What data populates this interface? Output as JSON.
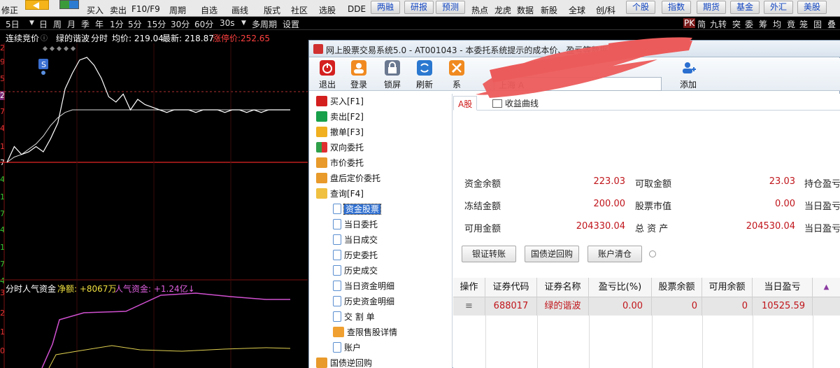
{
  "toolbar": {
    "left_label": "修正",
    "items": [
      "买入",
      "卖出",
      "F10/F9",
      "周期",
      "自选",
      "画线",
      "版式",
      "社区",
      "选股",
      "DDE"
    ],
    "pills_a": [
      "两融",
      "研报",
      "预测"
    ],
    "items_b": [
      "热点",
      "龙虎",
      "数据",
      "新股",
      "全球",
      "创/科"
    ],
    "pills_b": [
      "个股",
      "指数",
      "期货",
      "基金",
      "外汇",
      "美股"
    ]
  },
  "periodbar": {
    "left": [
      "5日",
      "日",
      "周",
      "月",
      "季",
      "年",
      "1分",
      "5分",
      "15分",
      "30分",
      "60分",
      "30s",
      "多周期",
      "设置"
    ],
    "right": [
      "PK",
      "简",
      "九转",
      "突",
      "委",
      "筹",
      "均",
      "竟",
      "笼",
      "固",
      "叠"
    ]
  },
  "chart": {
    "label_bid": "连续竞价",
    "stock_name": "绿的谐波",
    "mode": "分时",
    "avg_label": "均价: 219.04",
    "latest_label": "最新: 218.87",
    "limit_label": "涨停价:252.65",
    "marker_s": "S",
    "y_labels_price": [
      "2",
      "9",
      "5",
      "2",
      "7",
      "4",
      "1",
      "7",
      "4",
      "1",
      "7",
      "4",
      "1",
      "7",
      "4",
      "1"
    ],
    "sub_title": "分时人气资金",
    "sub_net": "净额: +8067万",
    "sub_pop": "人气资金: +1.24亿↓",
    "y_labels_sub": [
      "3",
      "2",
      "1",
      "0"
    ]
  },
  "chart_data": {
    "type": "line",
    "title": "",
    "series": [
      {
        "name": "",
        "values": [
          0.6,
          0.66,
          0.63,
          0.64,
          0.66,
          0.64,
          0.69,
          0.75,
          0.88,
          0.94,
          0.99,
          1.0,
          0.97,
          0.92,
          0.85,
          0.83,
          0.86,
          0.8,
          0.84,
          0.82,
          0.81,
          0.8,
          0.79,
          0.8,
          0.8,
          0.8,
          0.79,
          0.8,
          0.8,
          0.8,
          0.79,
          0.8,
          0.8,
          0.79,
          0.8,
          0.79,
          0.8,
          0.8,
          0.8,
          0.8
        ]
      },
      {
        "name": "",
        "values": [
          0.6,
          0.62,
          0.63,
          0.65,
          0.67,
          0.7,
          0.74,
          0.77,
          0.79,
          0.8,
          0.8,
          0.8,
          0.8,
          0.8,
          0.8,
          0.8,
          0.8,
          0.8,
          0.8,
          0.8,
          0.8,
          0.8,
          0.8,
          0.8,
          0.8,
          0.8,
          0.8,
          0.8,
          0.8,
          0.8,
          0.8,
          0.8,
          0.8,
          0.8,
          0.8,
          0.8,
          0.8,
          0.8,
          0.8,
          0.8
        ]
      }
    ]
  },
  "dialog": {
    "title": "网上股票交易系统5.0 - AT001043 - 本委托系统提示的成本价、盈亏等数据仅",
    "tools": [
      {
        "label": "退出",
        "icon": "power-icon",
        "color": "#d42020"
      },
      {
        "label": "登录",
        "icon": "user-icon",
        "color": "#f08a20"
      },
      {
        "label": "锁屏",
        "icon": "lock-icon",
        "color": "#6a7890"
      },
      {
        "label": "刷新",
        "icon": "refresh-icon",
        "color": "#2a78d0"
      },
      {
        "label": "系",
        "icon": "tools-icon",
        "color": "#f08a20"
      }
    ],
    "combo": "上海 A",
    "add_label": "添加",
    "tree": [
      {
        "label": "买入[F1]",
        "icon": "buy"
      },
      {
        "label": "卖出[F2]",
        "icon": "sell"
      },
      {
        "label": "撤单[F3]",
        "icon": "cancel"
      },
      {
        "label": "双向委托",
        "icon": "two"
      },
      {
        "label": "市价委托",
        "icon": "gen"
      },
      {
        "label": "盘后定价委托",
        "icon": "gen"
      },
      {
        "label": "查询[F4]",
        "icon": "q"
      }
    ],
    "subtree": [
      "资金股票",
      "当日委托",
      "当日成交",
      "历史委托",
      "历史成交",
      "当日资金明细",
      "历史资金明细",
      "交 割 单",
      "查限售股详情",
      "账户"
    ],
    "tree_last": "国债逆回购",
    "tabs": {
      "a": "A股",
      "b": "收益曲线"
    },
    "fields": [
      {
        "label": "资金余额",
        "value": "223.03"
      },
      {
        "label": "冻结金额",
        "value": "200.00"
      },
      {
        "label": "可用金额",
        "value": "204330.04"
      },
      {
        "label": "可取金额",
        "value": "23.03"
      },
      {
        "label": "股票市值",
        "value": "0.00"
      },
      {
        "label": "总 资 产",
        "value": "204530.04"
      }
    ],
    "fields_right": [
      "持仓盈亏",
      "当日盈亏",
      "当日盈亏"
    ],
    "buttons": [
      "银证转账",
      "国债逆回购",
      "账户清仓"
    ],
    "columns": [
      "操作",
      "证券代码",
      "证券名称",
      "盈亏比(%)",
      "股票余额",
      "可用余额",
      "当日盈亏"
    ],
    "rows": [
      {
        "op": "≡",
        "code": "688017",
        "name": "绿的谐波",
        "pct": "0.00",
        "bal": "0",
        "avail": "0",
        "pnl": "10525.59"
      }
    ]
  }
}
